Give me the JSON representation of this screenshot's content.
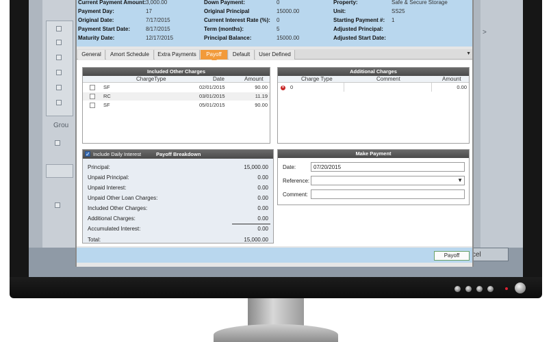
{
  "info": {
    "col1": [
      {
        "label": "Current Payment Amount:",
        "value": "3,000.00"
      },
      {
        "label": "Payment Day:",
        "value": "17"
      },
      {
        "label": "Original Date:",
        "value": "7/17/2015"
      },
      {
        "label": "Payment Start Date:",
        "value": "8/17/2015"
      },
      {
        "label": "Maturity Date:",
        "value": "12/17/2015"
      }
    ],
    "col2": [
      {
        "label": "Down Payment:",
        "value": "0"
      },
      {
        "label": "Original Principal",
        "value": "15000.00"
      },
      {
        "label": "Current Interest Rate (%):",
        "value": "0"
      },
      {
        "label": "Term (months):",
        "value": "5"
      },
      {
        "label": "Principal Balance:",
        "value": "15000.00"
      }
    ],
    "col3": [
      {
        "label": "Property:",
        "value": "Safe & Secure Storage"
      },
      {
        "label": "Unit:",
        "value": "SS25"
      },
      {
        "label": "Starting Payment #:",
        "value": "1"
      },
      {
        "label": "Adjusted Principal:",
        "value": ""
      },
      {
        "label": "Adjusted Start Date:",
        "value": ""
      }
    ]
  },
  "tabs": [
    "General",
    "Amort Schedule",
    "Extra Payments",
    "Payoff",
    "Default",
    "User Defined"
  ],
  "active_tab": "Payoff",
  "included_charges": {
    "title": "Included Other Charges",
    "columns": [
      "ChargeType",
      "Date",
      "Amount"
    ],
    "rows": [
      {
        "type": "SF",
        "date": "02/01/2015",
        "amount": "90.00"
      },
      {
        "type": "RC",
        "date": "03/01/2015",
        "amount": "11.19"
      },
      {
        "type": "SF",
        "date": "05/01/2015",
        "amount": "90.00"
      }
    ]
  },
  "additional_charges": {
    "title": "Additional Charges",
    "columns": [
      "Charge Type",
      "Comment",
      "Amount"
    ],
    "rows": [
      {
        "type": "0",
        "comment": "",
        "amount": "0.00"
      }
    ]
  },
  "payoff": {
    "include_daily_interest": "Include Daily Interest",
    "title": "Payoff Breakdown",
    "rows": [
      {
        "label": "Principal:",
        "value": "15,000.00"
      },
      {
        "label": "Unpaid Principal:",
        "value": "0.00"
      },
      {
        "label": "Unpaid Interest:",
        "value": "0.00"
      },
      {
        "label": "Unpaid Other Loan Charges:",
        "value": "0.00"
      },
      {
        "label": "Included Other Charges:",
        "value": "0.00"
      },
      {
        "label": "Additional Charges:",
        "value": "0.00"
      },
      {
        "label": "Accumulated Interest:",
        "value": "0.00"
      },
      {
        "label": "Total:",
        "value": "15,000.00"
      }
    ]
  },
  "make_payment": {
    "title": "Make Payment",
    "date_label": "Date:",
    "date_value": "07/20/2015",
    "reference_label": "Reference:",
    "reference_value": "",
    "comment_label": "Comment:",
    "comment_value": ""
  },
  "footer": {
    "payoff_button": "Payoff"
  },
  "background": {
    "group_text": "Grou",
    "cancel_text": "cel",
    "arrow_text": ">"
  }
}
